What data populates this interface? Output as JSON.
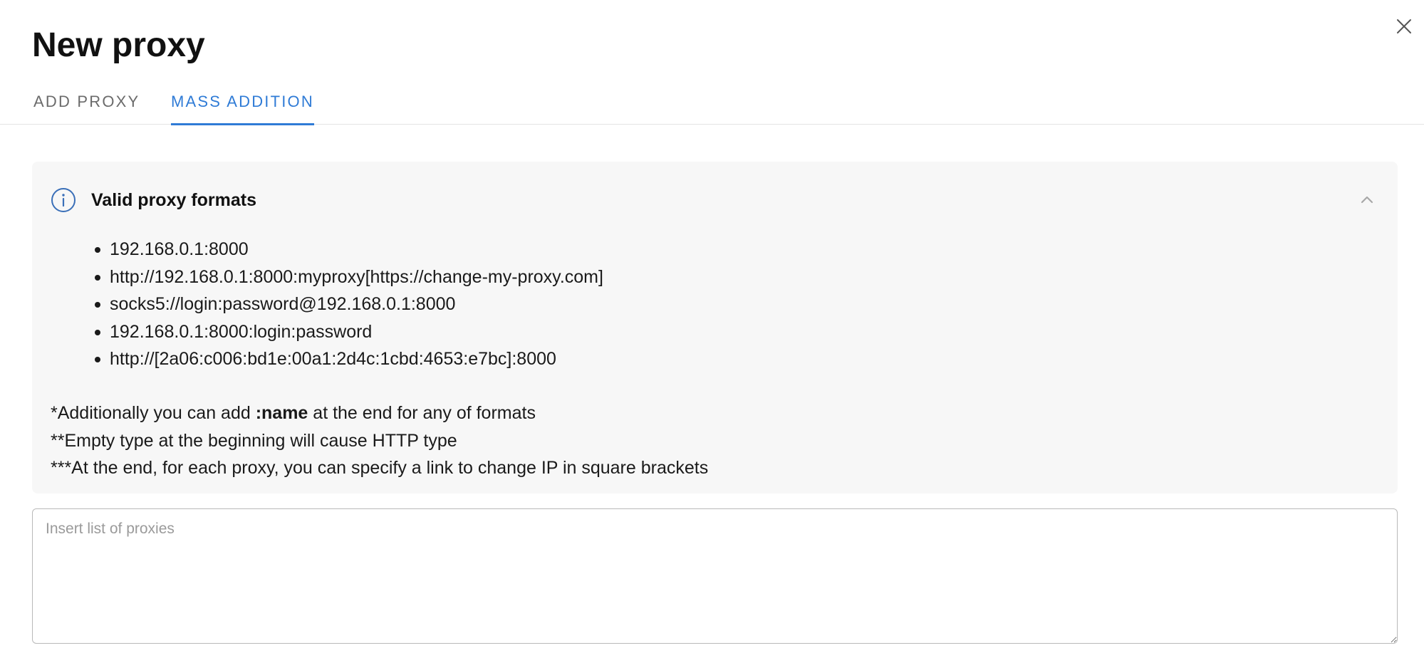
{
  "dialog": {
    "title": "New proxy",
    "close_icon": "close-icon"
  },
  "tabs": [
    {
      "label": "ADD PROXY",
      "active": false
    },
    {
      "label": "MASS ADDITION",
      "active": true
    }
  ],
  "accent_color": "#2f7bd6",
  "formats_panel": {
    "icon": "info-icon",
    "title": "Valid proxy formats",
    "collapse_icon": "chevron-up-icon",
    "items": [
      "192.168.0.1:8000",
      "http://192.168.0.1:8000:myproxy[https://change-my-proxy.com]",
      "socks5://login:password@192.168.0.1:8000",
      "192.168.0.1:8000:login:password",
      "http://[2a06:c006:bd1e:00a1:2d4c:1cbd:4653:e7bc]:8000"
    ],
    "note1": {
      "prefix": "*Additionally you can add ",
      "bold": ":name",
      "suffix": " at the end for any of formats"
    },
    "note2": "**Empty type at the beginning will cause HTTP type",
    "note3": "***At the end, for each proxy, you can specify a link to change IP in square brackets"
  },
  "proxy_list": {
    "placeholder": "Insert list of proxies",
    "value": ""
  }
}
